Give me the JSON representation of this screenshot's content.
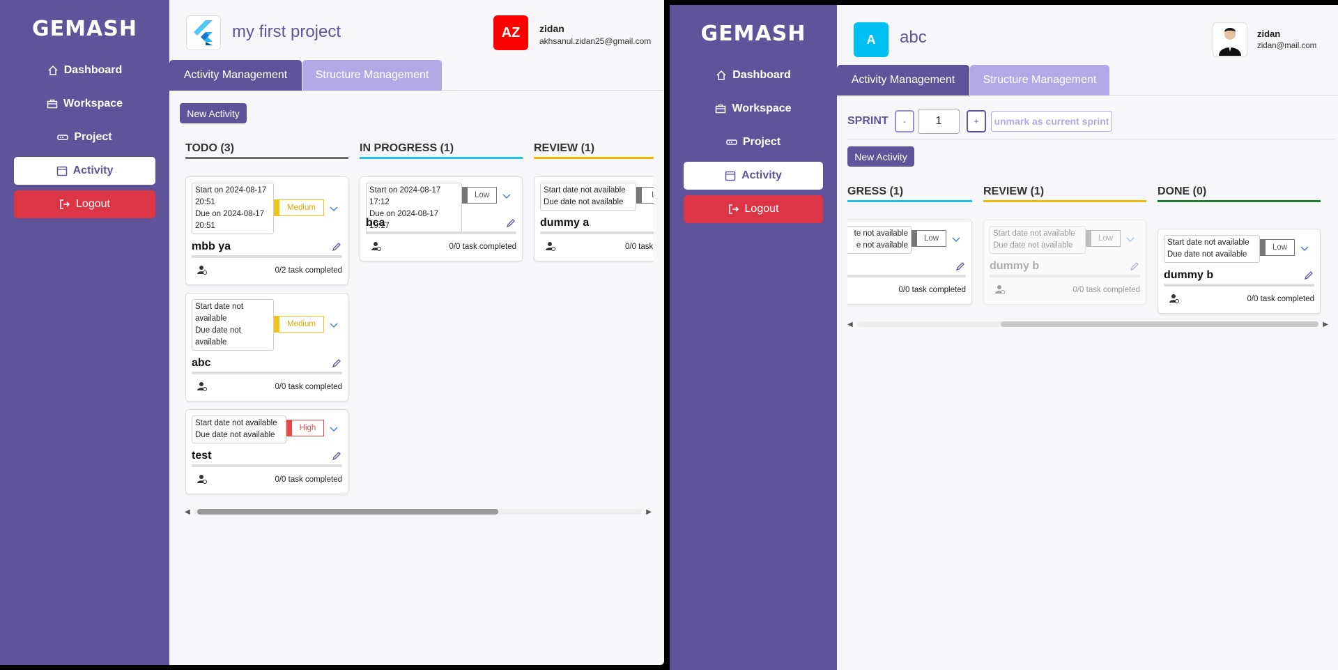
{
  "left": {
    "brand": "GEMASH",
    "nav": {
      "dashboard": "Dashboard",
      "workspace": "Workspace",
      "project": "Project",
      "activity": "Activity",
      "logout": "Logout"
    },
    "project_title": "my first project",
    "user": {
      "initials": "AZ",
      "name": "zidan",
      "email": "akhsanul.zidan25@gmail.com",
      "avatar_color": "#ff0000"
    },
    "tabs": {
      "activity": "Activity Management",
      "structure": "Structure Management"
    },
    "new_activity": "New Activity",
    "columns": [
      {
        "title": "TODO (3)",
        "color": "#6c6c6c"
      },
      {
        "title": "IN PROGRESS (1)",
        "color": "#22c2e8"
      },
      {
        "title": "REVIEW (1)",
        "color": "#f0b800"
      }
    ],
    "cards": [
      {
        "dates": [
          "Start on 2024-08-17",
          "20:51",
          "Due on 2024-08-17",
          "20:51"
        ],
        "priority": "Medium",
        "title": "mbb ya",
        "tasks": "0/2 task completed"
      },
      {
        "dates": [
          "Start date not",
          "available",
          "Due date not",
          "available"
        ],
        "priority": "Medium",
        "title": "abc",
        "tasks": "0/0 task completed"
      },
      {
        "dates": [
          "Start date not available",
          "Due date not available"
        ],
        "priority": "High",
        "title": "test",
        "tasks": "0/0 task completed"
      },
      {
        "dates": [
          "Start on 2024-08-17 17:12",
          "Due on 2024-08-17 19:17"
        ],
        "priority": "Low",
        "title": "bca",
        "tasks": "0/0 task completed"
      },
      {
        "dates": [
          "Start date not available",
          "Due date not available"
        ],
        "priority": "Lo",
        "title": "dummy a",
        "tasks": "0/0 task"
      }
    ]
  },
  "right": {
    "brand": "GEMASH",
    "nav": {
      "dashboard": "Dashboard",
      "workspace": "Workspace",
      "project": "Project",
      "activity": "Activity",
      "logout": "Logout"
    },
    "project_initial": "A",
    "project_title": "abc",
    "user": {
      "name": "zidan",
      "email": "zidan@mail.com"
    },
    "tabs": {
      "activity": "Activity Management",
      "structure": "Structure Management"
    },
    "sprint": {
      "label": "SPRINT",
      "minus": "-",
      "value": "1",
      "plus": "+",
      "unmark": "unmark as current sprint"
    },
    "new_activity": "New Activity",
    "columns": [
      {
        "title": "GRESS (1)",
        "color": "#22c2e8"
      },
      {
        "title": "REVIEW (1)",
        "color": "#f0b800"
      },
      {
        "title": "DONE (0)",
        "color": "#1e7e34"
      }
    ],
    "cards": [
      {
        "dates": [
          "te not available",
          "e not available"
        ],
        "priority": "Low",
        "title": "",
        "tasks": "0/0 task completed"
      },
      {
        "dates": [
          "Start date not available",
          "Due date not available"
        ],
        "priority": "Low",
        "title": "dummy b",
        "tasks": "0/0 task completed"
      },
      {
        "dates": [
          "Start date not available",
          "Due date not available"
        ],
        "priority": "Low",
        "title": "dummy b",
        "tasks": "0/0 task completed"
      }
    ]
  }
}
